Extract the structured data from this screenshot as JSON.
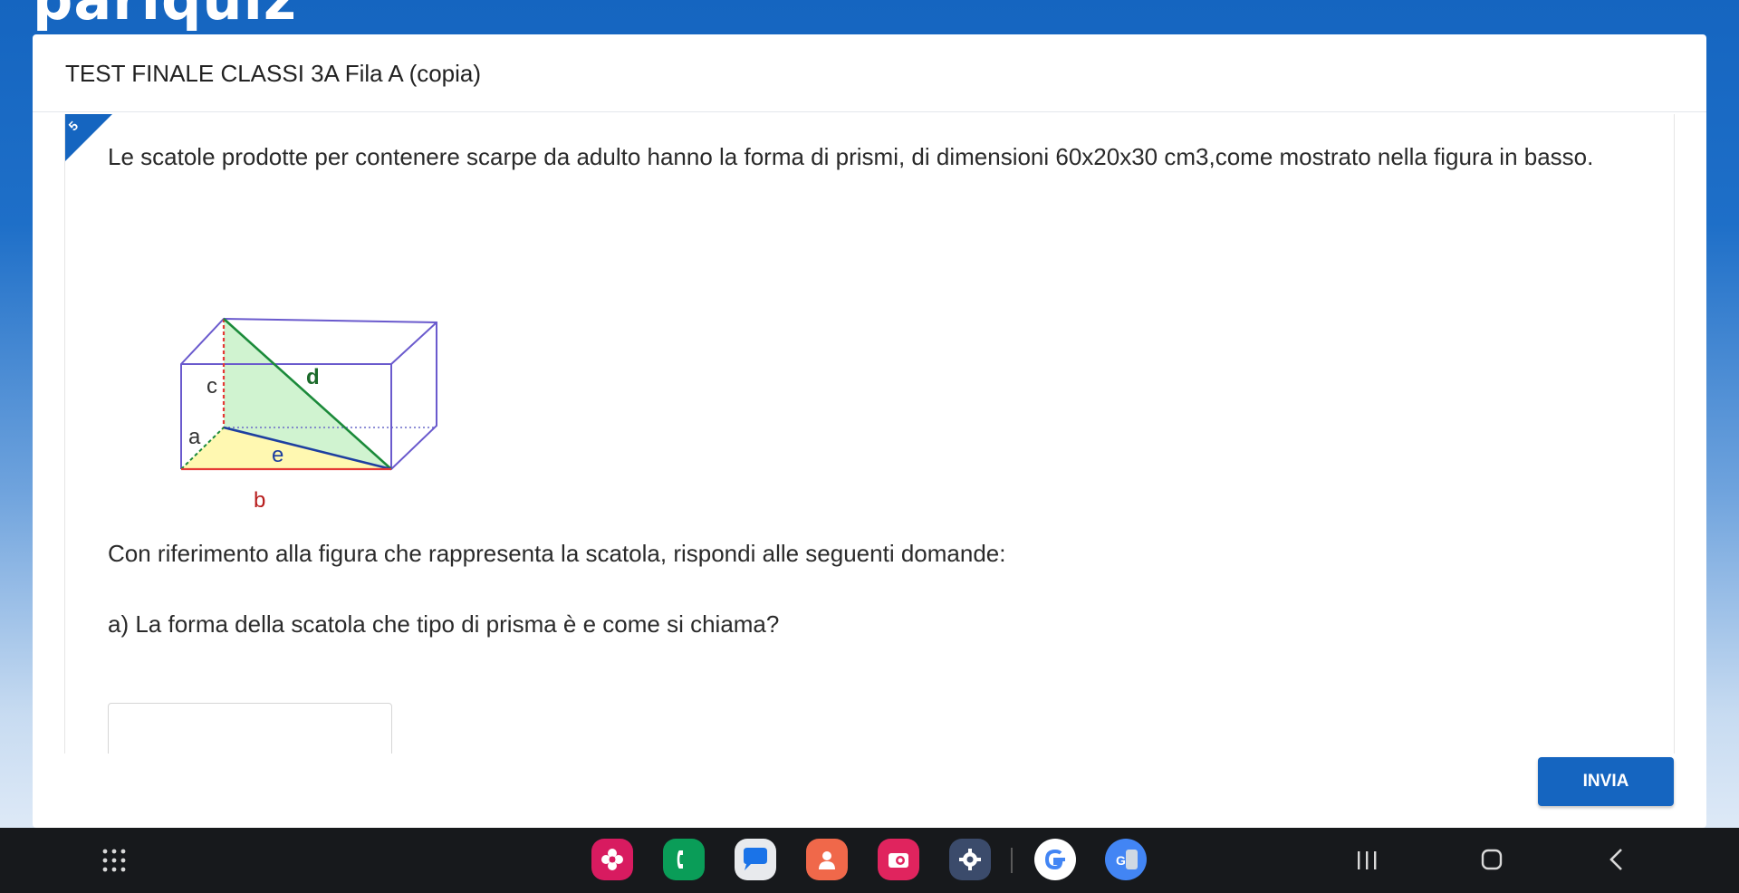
{
  "app": {
    "logo": "pariquiz"
  },
  "quiz": {
    "title": "TEST FINALE CLASSI 3A Fila A (copia)"
  },
  "question": {
    "number": "5",
    "text": "Le scatole prodotte per contenere scarpe da adulto hanno la forma di prismi, di dimensioni 60x20x30 cm3,come mostrato nella figura in basso.",
    "figure_labels": {
      "c": "c",
      "d": "d",
      "a": "a",
      "e": "e",
      "b": "b"
    },
    "instruction": "Con riferimento alla figura che rappresenta la scatola, rispondi alle seguenti domande:",
    "sub_a": "a) La forma della scatola che tipo di prisma è e come si chiama?",
    "answer_value": ""
  },
  "actions": {
    "submit_label": "INVIA"
  },
  "taskbar": {
    "apps": [
      {
        "icon": "flower-app-icon",
        "color": "#d81b60"
      },
      {
        "icon": "phone-icon",
        "color": "#0a9d58"
      },
      {
        "icon": "messages-icon",
        "color": "#e8eaed"
      },
      {
        "icon": "contacts-icon",
        "color": "#f0684a"
      },
      {
        "icon": "camera-icon",
        "color": "#e0245e"
      },
      {
        "icon": "settings-icon",
        "color": "#3b4b6b"
      },
      {
        "icon": "google-icon",
        "color": "#ffffff"
      },
      {
        "icon": "translate-icon",
        "color": "#4285f4"
      }
    ]
  }
}
